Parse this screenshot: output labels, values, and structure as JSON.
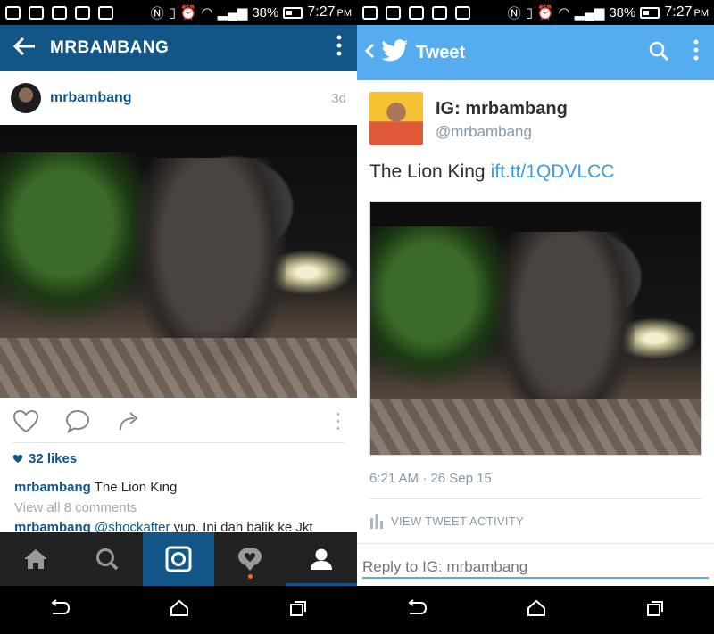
{
  "status_bar": {
    "battery": "38%",
    "time": "7:27",
    "ampm": "PM"
  },
  "instagram": {
    "title": "MRBAMBANG",
    "username": "mrbambang",
    "post_age": "3d",
    "likes": "32 likes",
    "caption_user": "mrbambang",
    "caption_text": "The Lion King",
    "view_all_comments": "View all 8 comments",
    "comment_user": "mrbambang",
    "comment_mention": "@shockafter",
    "comment_text": "yup. Ini dah balik ke Jkt",
    "accent_color": "#125688",
    "icons": {
      "back": "back-arrow-icon",
      "more": "overflow-menu-icon",
      "like": "heart-icon",
      "comment": "comment-bubble-icon",
      "share": "share-arrow-icon",
      "tabs": [
        "home-icon",
        "search-icon",
        "camera-icon",
        "activity-icon",
        "profile-icon"
      ]
    }
  },
  "twitter": {
    "header_title": "Tweet",
    "display_name": "IG: mrbambang",
    "handle": "@mrbambang",
    "tweet_text": "The Lion King",
    "tweet_link": "ift.tt/1QDVLCC",
    "timestamp": "6:21 AM · 26 Sep 15",
    "view_activity": "VIEW TWEET ACTIVITY",
    "reply_placeholder": "Reply to IG: mrbambang",
    "accent_color": "#55acee"
  }
}
